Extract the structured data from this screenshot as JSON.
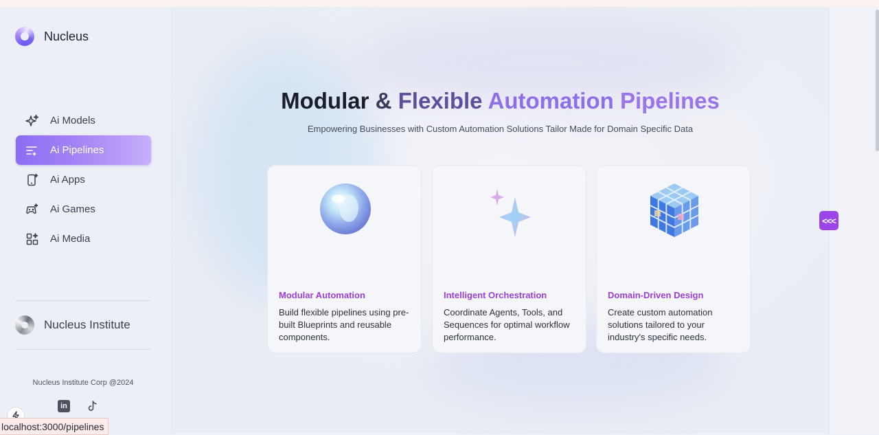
{
  "brand": {
    "name": "Nucleus"
  },
  "nav": {
    "items": [
      {
        "label": "Ai Models",
        "icon": "sparkle-icon",
        "active": false
      },
      {
        "label": "Ai Pipelines",
        "icon": "pipeline-icon",
        "active": true
      },
      {
        "label": "Ai Apps",
        "icon": "phone-icon",
        "active": false
      },
      {
        "label": "Ai Games",
        "icon": "gamepad-icon",
        "active": false
      },
      {
        "label": "Ai Media",
        "icon": "media-grid-icon",
        "active": false
      }
    ]
  },
  "institute": {
    "name": "Nucleus Institute"
  },
  "footer": {
    "corp": "Nucleus Institute Corp @2024",
    "socials": [
      "linkedin-icon",
      "tiktok-icon"
    ],
    "linkedin_glyph": "in"
  },
  "status_bar": {
    "url": "localhost:3000/pipelines"
  },
  "hero": {
    "title_parts": [
      "Modular",
      "&",
      "Flexible",
      "Automation",
      "Pipelines"
    ],
    "subtitle": "Empowering Businesses with Custom Automation Solutions Tailor Made for Domain Specific Data"
  },
  "panel_toggle": {
    "label": "<<<"
  },
  "cards": [
    {
      "title": "Modular Automation",
      "description": "Build flexible pipelines using pre-built Blueprints and reusable components.",
      "art": "glass-sphere-icon"
    },
    {
      "title": "Intelligent Orchestration",
      "description": "Coordinate Agents, Tools, and Sequences for optimal workflow performance.",
      "art": "sparkle-stars-icon"
    },
    {
      "title": "Domain-Driven Design",
      "description": "Create custom automation solutions tailored to your industry's specific needs.",
      "art": "cube-icon"
    }
  ],
  "colors": {
    "accent": "#9b45e8",
    "active_nav": "#8b6df3",
    "card_title": "#9b3fd8"
  }
}
